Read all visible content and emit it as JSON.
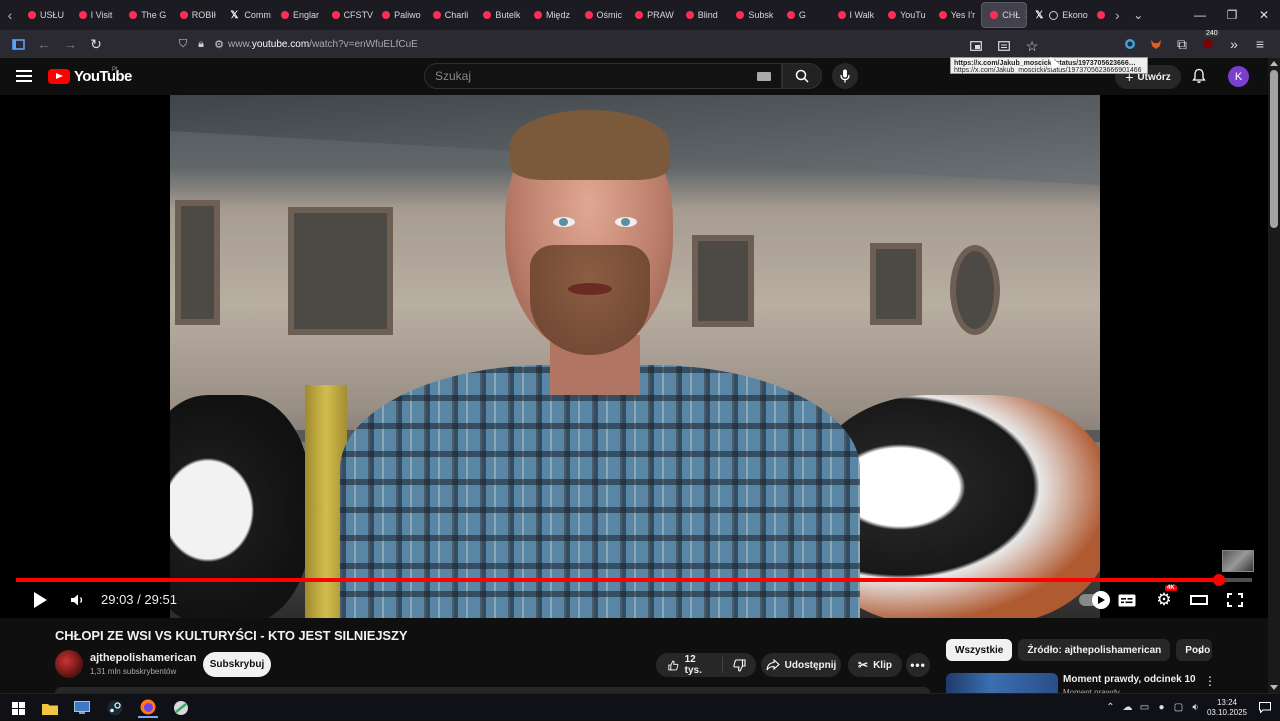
{
  "browser": {
    "tabs": [
      {
        "label": "USŁU",
        "favicon": "youtube-favicon"
      },
      {
        "label": "I Visit",
        "favicon": "youtube-favicon"
      },
      {
        "label": "The G",
        "favicon": "youtube-favicon"
      },
      {
        "label": "ROBIł",
        "favicon": "youtube-favicon"
      },
      {
        "label": "Comm",
        "favicon": "x-favicon"
      },
      {
        "label": "Englar",
        "favicon": "youtube-favicon"
      },
      {
        "label": "CFSTV",
        "favicon": "youtube-favicon"
      },
      {
        "label": "Paliwo",
        "favicon": "youtube-favicon"
      },
      {
        "label": "Charli",
        "favicon": "youtube-favicon"
      },
      {
        "label": "Butelk",
        "favicon": "youtube-favicon"
      },
      {
        "label": "Międz",
        "favicon": "youtube-favicon"
      },
      {
        "label": "Ośmic",
        "favicon": "youtube-favicon"
      },
      {
        "label": "PRAW",
        "favicon": "youtube-favicon"
      },
      {
        "label": "Blind",
        "favicon": "youtube-favicon"
      },
      {
        "label": "Subsk",
        "favicon": "youtube-favicon"
      },
      {
        "label": "G",
        "favicon": "youtube-favicon"
      },
      {
        "label": "I Walk",
        "favicon": "youtube-favicon"
      },
      {
        "label": "YouTu",
        "favicon": "youtube-favicon"
      },
      {
        "label": "Yes I'r",
        "favicon": "youtube-favicon"
      }
    ],
    "active_tab": {
      "label": "CHŁ",
      "close": "✕"
    },
    "next_tabs": [
      {
        "label": "Ekono",
        "favicon": "x-favicon"
      }
    ],
    "url_prefix": "www.",
    "url_domain": "youtube.com",
    "url_path": "/watch?v=enWfuELfCuE",
    "ext_badge": "240",
    "tooltip_line1": "https://x.com/Jakub_moscicki/status/1973705623666…",
    "tooltip_line2": "https://x.com/Jakub_moscicki/status/1973705623666901466"
  },
  "masthead": {
    "logo_text": "YouTube",
    "country": "PL",
    "search_placeholder": "Szukaj",
    "create_label": "Utwórz",
    "avatar_letter": "K"
  },
  "player": {
    "current_time": "29:03",
    "separator": " / ",
    "duration": "29:51",
    "progress": 0.9732,
    "quality_badge": "4K"
  },
  "video": {
    "title": "CHŁOPI ZE WSI VS KULTURYŚCI - KTO JEST SILNIEJSZY",
    "channel": "ajthepolishamerican",
    "subscribers": "1,31 mln subskrybentów",
    "subscribe_label": "Subskrybuj",
    "likes": "12 tys.",
    "share_label": "Udostępnij",
    "clip_label": "Klip"
  },
  "sidebar": {
    "chips": [
      "Wszystkie",
      "Źródło: ajthepolishamerican",
      "Podo"
    ],
    "rec_title": "Moment prawdy, odcinek 10",
    "rec_sub": "Moment prawdy"
  },
  "taskbar": {
    "time": "13:24",
    "date": "03.10.2025"
  },
  "colors": {
    "youtube_red": "#ff0000",
    "page_bg": "#0f0f0f",
    "avatar": "#7b3fd0"
  }
}
